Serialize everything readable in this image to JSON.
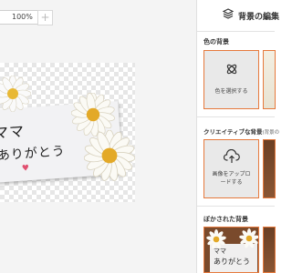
{
  "toolbar": {
    "zoom_value": "100%",
    "zoom_plus": "+"
  },
  "canvas": {
    "note_line1": "ママ",
    "note_line2": "ありがとう",
    "heart": "♥"
  },
  "panel": {
    "title": "背景の編集",
    "sections": {
      "color_label": "色の背景",
      "color_card_label": "色を選択する",
      "creative_label": "クリエイティブな背景",
      "creative_label_note": "(背景の",
      "upload_card_label_line1": "画像をアップロ",
      "upload_card_label_line2": "ードする",
      "blur_label": "ぼかされた背景",
      "blur_note_line1": "ママ",
      "blur_note_line2": "ありがとう"
    }
  },
  "colors": {
    "accent": "#e6793c",
    "panel_bg": "#ffffff",
    "editor_bg": "#f4f4f4",
    "card_bg": "#e9e9e9"
  },
  "icons": [
    "layers-icon",
    "palette-icon",
    "upload-cloud-icon",
    "daisy-flower"
  ]
}
